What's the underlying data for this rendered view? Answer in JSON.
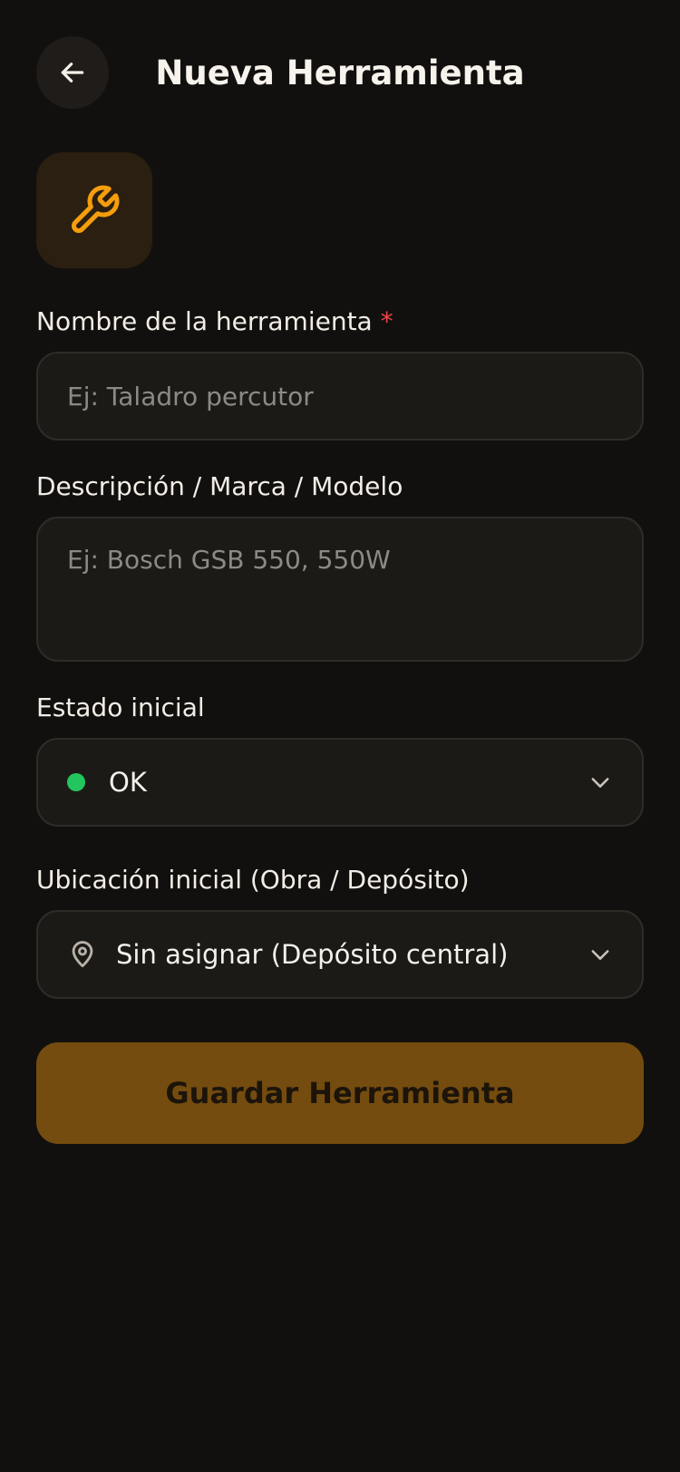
{
  "header": {
    "title": "Nueva Herramienta",
    "back_icon": "arrow-left-icon"
  },
  "tool_icon": "wrench-icon",
  "form": {
    "name": {
      "label": "Nombre de la herramienta",
      "required_mark": "*",
      "placeholder": "Ej: Taladro percutor",
      "value": ""
    },
    "description": {
      "label": "Descripción / Marca / Modelo",
      "placeholder": "Ej: Bosch GSB 550, 550W",
      "value": ""
    },
    "status": {
      "label": "Estado inicial",
      "value": "OK",
      "dot_color": "#22c55e"
    },
    "location": {
      "label": "Ubicación inicial (Obra / Depósito)",
      "value": "Sin asignar (Depósito central)",
      "icon": "map-pin-icon"
    }
  },
  "save_button": {
    "label": "Guardar Herramienta"
  },
  "colors": {
    "background": "#12100e",
    "accent": "#f59e0b",
    "button": "#744c0f",
    "required": "#ef4444"
  }
}
